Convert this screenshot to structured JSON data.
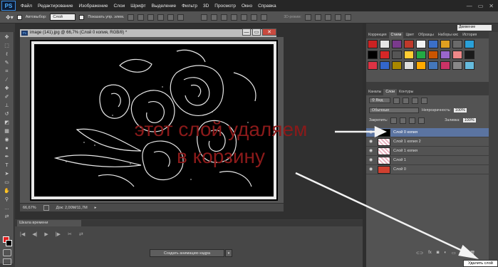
{
  "app": {
    "logo": "PS"
  },
  "menubar": {
    "items": [
      "Файл",
      "Редактирование",
      "Изображение",
      "Слои",
      "Шрифт",
      "Выделение",
      "Фильтр",
      "3D",
      "Просмотр",
      "Окно",
      "Справка"
    ],
    "controls": [
      "—",
      "▭",
      "✕"
    ]
  },
  "options_bar": {
    "auto_select_label": "Автовыбор:",
    "auto_select_value": "Слой",
    "show_transform_label": "Показать упр. элем.",
    "mode_3d_label": "3D-режим:"
  },
  "workspace": {
    "selected": "Движение"
  },
  "document": {
    "tab_title": "image (141).jpg @ 66,7% (Слой 0 копия, RGB/8) *",
    "zoom": "66,67%",
    "doc_size": "Док: 2,00M/11,7M",
    "window_controls": [
      "—",
      "▭",
      "✕"
    ]
  },
  "timeline": {
    "tab_label": "Шкала времени",
    "create_button": "Создать анимацию кадра",
    "controls": [
      "|◀",
      "◀|",
      "▶",
      "|▶",
      "✂",
      "⇄"
    ]
  },
  "styles_panel": {
    "tabs": [
      "Коррекция",
      "Стили",
      "Цвет",
      "Образцы",
      "Наборы кис",
      "История"
    ],
    "active_tab": "Стили",
    "swatches": [
      "#cc2222",
      "#e6e6e6",
      "#7a3a8c",
      "#c0392b",
      "#f2f2f2",
      "#3b6fc8",
      "#e0a020",
      "#6a6a6a",
      "#2aa0d8",
      "#000000",
      "#d62727",
      "#555555",
      "#ffcc33",
      "#22aa44",
      "#cc5500",
      "#9966cc",
      "#ee8888",
      "#1a1a1a",
      "#dd3344",
      "#3366cc",
      "#aa8800",
      "#dddddd",
      "#ffaa00",
      "#4477bb",
      "#cc3366",
      "#888888",
      "#66bbdd"
    ]
  },
  "layers_panel": {
    "tabs": [
      "Каналы",
      "Слои",
      "Контуры"
    ],
    "active_tab": "Слои",
    "filter_label": "Вид",
    "blend_mode": "Обычные",
    "opacity_label": "Непрозрачность:",
    "opacity_value": "100%",
    "lock_label": "Закрепить:",
    "fill_label": "Заливка:",
    "fill_value": "100%",
    "layers": [
      {
        "name": "Слой 0 копия",
        "selected": true
      },
      {
        "name": "Слой 1 копия 2",
        "selected": false
      },
      {
        "name": "Слой 1 копия",
        "selected": false
      },
      {
        "name": "Слой 1",
        "selected": false
      },
      {
        "name": "Слой 0",
        "selected": false
      }
    ],
    "bottom_icons": [
      "link-icon",
      "fx-icon",
      "mask-icon",
      "adjustment-icon",
      "folder-icon",
      "new-layer-icon",
      "trash-icon"
    ]
  },
  "tooltip": {
    "text": "Удалить слой"
  },
  "annotation": {
    "line1": "этот слой удаляем",
    "line2": "в корзину",
    "color": "#8b1a1a"
  }
}
